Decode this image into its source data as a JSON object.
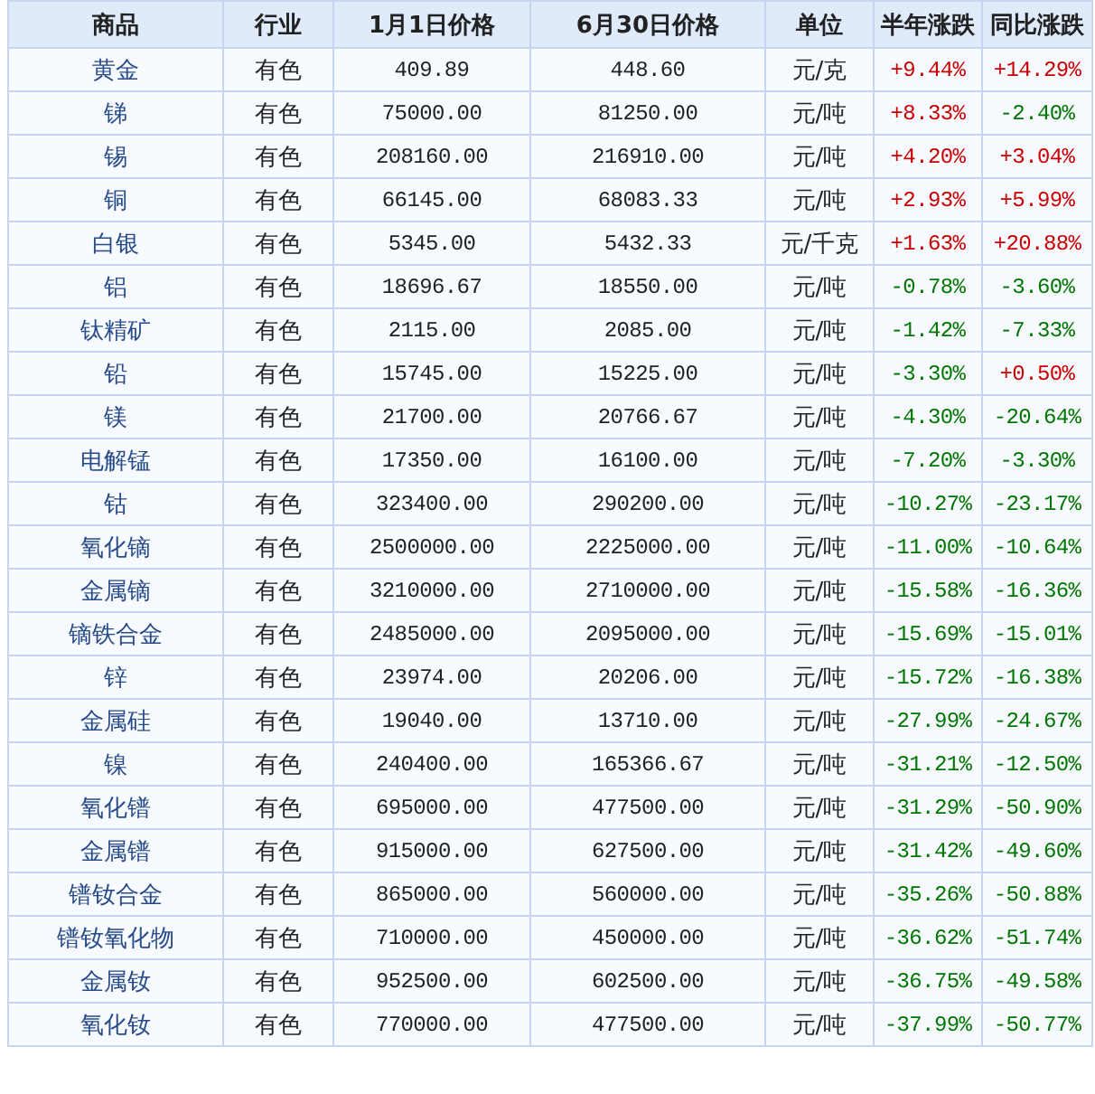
{
  "table": {
    "columns": [
      "商品",
      "行业",
      "1月1日价格",
      "6月30日价格",
      "单位",
      "半年涨跌",
      "同比涨跌"
    ],
    "rows": [
      {
        "name": "黄金",
        "industry": "有色",
        "price_jan1": "409.89",
        "price_jun30": "448.60",
        "unit": "元/克",
        "half_year": {
          "text": "+9.44%",
          "color": "#cc0000"
        },
        "yoy": {
          "text": "+14.29%",
          "color": "#cc0000"
        }
      },
      {
        "name": "锑",
        "industry": "有色",
        "price_jan1": "75000.00",
        "price_jun30": "81250.00",
        "unit": "元/吨",
        "half_year": {
          "text": "+8.33%",
          "color": "#cc0000"
        },
        "yoy": {
          "text": "-2.40%",
          "color": "#007700"
        }
      },
      {
        "name": "锡",
        "industry": "有色",
        "price_jan1": "208160.00",
        "price_jun30": "216910.00",
        "unit": "元/吨",
        "half_year": {
          "text": "+4.20%",
          "color": "#cc0000"
        },
        "yoy": {
          "text": "+3.04%",
          "color": "#cc0000"
        }
      },
      {
        "name": "铜",
        "industry": "有色",
        "price_jan1": "66145.00",
        "price_jun30": "68083.33",
        "unit": "元/吨",
        "half_year": {
          "text": "+2.93%",
          "color": "#cc0000"
        },
        "yoy": {
          "text": "+5.99%",
          "color": "#cc0000"
        }
      },
      {
        "name": "白银",
        "industry": "有色",
        "price_jan1": "5345.00",
        "price_jun30": "5432.33",
        "unit": "元/千克",
        "half_year": {
          "text": "+1.63%",
          "color": "#cc0000"
        },
        "yoy": {
          "text": "+20.88%",
          "color": "#cc0000"
        }
      },
      {
        "name": "铝",
        "industry": "有色",
        "price_jan1": "18696.67",
        "price_jun30": "18550.00",
        "unit": "元/吨",
        "half_year": {
          "text": "-0.78%",
          "color": "#007700"
        },
        "yoy": {
          "text": "-3.60%",
          "color": "#007700"
        }
      },
      {
        "name": "钛精矿",
        "industry": "有色",
        "price_jan1": "2115.00",
        "price_jun30": "2085.00",
        "unit": "元/吨",
        "half_year": {
          "text": "-1.42%",
          "color": "#007700"
        },
        "yoy": {
          "text": "-7.33%",
          "color": "#007700"
        }
      },
      {
        "name": "铅",
        "industry": "有色",
        "price_jan1": "15745.00",
        "price_jun30": "15225.00",
        "unit": "元/吨",
        "half_year": {
          "text": "-3.30%",
          "color": "#007700"
        },
        "yoy": {
          "text": "+0.50%",
          "color": "#cc0000"
        }
      },
      {
        "name": "镁",
        "industry": "有色",
        "price_jan1": "21700.00",
        "price_jun30": "20766.67",
        "unit": "元/吨",
        "half_year": {
          "text": "-4.30%",
          "color": "#007700"
        },
        "yoy": {
          "text": "-20.64%",
          "color": "#007700"
        }
      },
      {
        "name": "电解锰",
        "industry": "有色",
        "price_jan1": "17350.00",
        "price_jun30": "16100.00",
        "unit": "元/吨",
        "half_year": {
          "text": "-7.20%",
          "color": "#007700"
        },
        "yoy": {
          "text": "-3.30%",
          "color": "#007700"
        }
      },
      {
        "name": "钴",
        "industry": "有色",
        "price_jan1": "323400.00",
        "price_jun30": "290200.00",
        "unit": "元/吨",
        "half_year": {
          "text": "-10.27%",
          "color": "#007700"
        },
        "yoy": {
          "text": "-23.17%",
          "color": "#007700"
        }
      },
      {
        "name": "氧化镝",
        "industry": "有色",
        "price_jan1": "2500000.00",
        "price_jun30": "2225000.00",
        "unit": "元/吨",
        "half_year": {
          "text": "-11.00%",
          "color": "#007700"
        },
        "yoy": {
          "text": "-10.64%",
          "color": "#007700"
        }
      },
      {
        "name": "金属镝",
        "industry": "有色",
        "price_jan1": "3210000.00",
        "price_jun30": "2710000.00",
        "unit": "元/吨",
        "half_year": {
          "text": "-15.58%",
          "color": "#007700"
        },
        "yoy": {
          "text": "-16.36%",
          "color": "#007700"
        }
      },
      {
        "name": "镝铁合金",
        "industry": "有色",
        "price_jan1": "2485000.00",
        "price_jun30": "2095000.00",
        "unit": "元/吨",
        "half_year": {
          "text": "-15.69%",
          "color": "#007700"
        },
        "yoy": {
          "text": "-15.01%",
          "color": "#007700"
        }
      },
      {
        "name": "锌",
        "industry": "有色",
        "price_jan1": "23974.00",
        "price_jun30": "20206.00",
        "unit": "元/吨",
        "half_year": {
          "text": "-15.72%",
          "color": "#007700"
        },
        "yoy": {
          "text": "-16.38%",
          "color": "#007700"
        }
      },
      {
        "name": "金属硅",
        "industry": "有色",
        "price_jan1": "19040.00",
        "price_jun30": "13710.00",
        "unit": "元/吨",
        "half_year": {
          "text": "-27.99%",
          "color": "#007700"
        },
        "yoy": {
          "text": "-24.67%",
          "color": "#007700"
        }
      },
      {
        "name": "镍",
        "industry": "有色",
        "price_jan1": "240400.00",
        "price_jun30": "165366.67",
        "unit": "元/吨",
        "half_year": {
          "text": "-31.21%",
          "color": "#007700"
        },
        "yoy": {
          "text": "-12.50%",
          "color": "#007700"
        }
      },
      {
        "name": "氧化镨",
        "industry": "有色",
        "price_jan1": "695000.00",
        "price_jun30": "477500.00",
        "unit": "元/吨",
        "half_year": {
          "text": "-31.29%",
          "color": "#007700"
        },
        "yoy": {
          "text": "-50.90%",
          "color": "#007700"
        }
      },
      {
        "name": "金属镨",
        "industry": "有色",
        "price_jan1": "915000.00",
        "price_jun30": "627500.00",
        "unit": "元/吨",
        "half_year": {
          "text": "-31.42%",
          "color": "#007700"
        },
        "yoy": {
          "text": "-49.60%",
          "color": "#007700"
        }
      },
      {
        "name": "镨钕合金",
        "industry": "有色",
        "price_jan1": "865000.00",
        "price_jun30": "560000.00",
        "unit": "元/吨",
        "half_year": {
          "text": "-35.26%",
          "color": "#007700"
        },
        "yoy": {
          "text": "-50.88%",
          "color": "#007700"
        }
      },
      {
        "name": "镨钕氧化物",
        "industry": "有色",
        "price_jan1": "710000.00",
        "price_jun30": "450000.00",
        "unit": "元/吨",
        "half_year": {
          "text": "-36.62%",
          "color": "#007700"
        },
        "yoy": {
          "text": "-51.74%",
          "color": "#007700"
        }
      },
      {
        "name": "金属钕",
        "industry": "有色",
        "price_jan1": "952500.00",
        "price_jun30": "602500.00",
        "unit": "元/吨",
        "half_year": {
          "text": "-36.75%",
          "color": "#007700"
        },
        "yoy": {
          "text": "-49.58%",
          "color": "#007700"
        }
      },
      {
        "name": "氧化钕",
        "industry": "有色",
        "price_jan1": "770000.00",
        "price_jun30": "477500.00",
        "unit": "元/吨",
        "half_year": {
          "text": "-37.99%",
          "color": "#007700"
        },
        "yoy": {
          "text": "-50.77%",
          "color": "#007700"
        }
      }
    ]
  }
}
